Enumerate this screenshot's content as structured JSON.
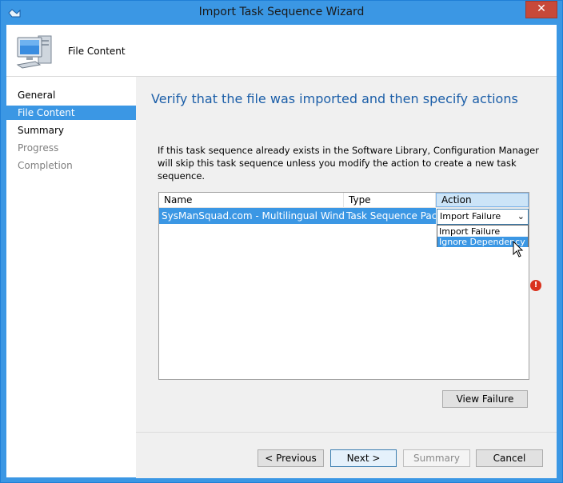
{
  "window": {
    "title": "Import Task Sequence Wizard",
    "close_glyph": "✕"
  },
  "banner": {
    "page_name": "File Content",
    "icon": "computer-icon"
  },
  "nav": {
    "items": [
      {
        "label": "General",
        "state": "normal"
      },
      {
        "label": "File Content",
        "state": "active"
      },
      {
        "label": "Summary",
        "state": "normal"
      },
      {
        "label": "Progress",
        "state": "disabled"
      },
      {
        "label": "Completion",
        "state": "disabled"
      }
    ]
  },
  "main": {
    "heading": "Verify that the file was imported and then specify actions",
    "description": "If this task sequence already exists in the Software Library, Configuration Manager will skip this task sequence unless you modify the action to create a new task sequence."
  },
  "listview": {
    "columns": [
      "Name",
      "Type",
      "Action"
    ],
    "rows": [
      {
        "name": "SysManSquad.com - Multilingual Windo...",
        "type": "Task Sequence Pac...",
        "action": "Import Failure"
      }
    ],
    "dropdown": {
      "selected": "Import Failure",
      "options": [
        "Import Failure",
        "Ignore Dependency"
      ],
      "highlighted": "Ignore Dependency"
    }
  },
  "buttons": {
    "view_failure": "View Failure",
    "previous": "< Previous",
    "next": "Next >",
    "summary": "Summary",
    "cancel": "Cancel"
  },
  "colors": {
    "accent": "#3b97e4",
    "heading": "#1b5ea8",
    "error": "#d9321d"
  }
}
